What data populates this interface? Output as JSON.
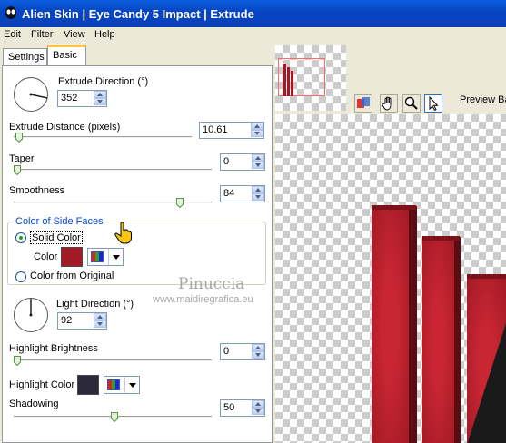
{
  "window": {
    "title": "Alien Skin | Eye Candy 5 Impact | Extrude"
  },
  "menu": [
    "Edit",
    "Filter",
    "View",
    "Help"
  ],
  "tabs": [
    {
      "label": "Settings",
      "active": false
    },
    {
      "label": "Basic",
      "active": true
    }
  ],
  "basic": {
    "extrude_direction": {
      "label": "Extrude Direction (°)",
      "value": "352"
    },
    "extrude_distance": {
      "label": "Extrude Distance (pixels)",
      "value": "10.61",
      "slider_fraction": 0.02
    },
    "taper": {
      "label": "Taper",
      "value": "0",
      "slider_fraction": 0.0
    },
    "smoothness": {
      "label": "Smoothness",
      "value": "84",
      "slider_fraction": 0.84
    },
    "side_faces": {
      "group_label": "Color of Side Faces",
      "solid_color_label": "Solid Color",
      "color_label": "Color",
      "color_value": "#a11a25",
      "from_original_label": "Color from Original",
      "selected": "solid"
    },
    "light_direction": {
      "label": "Light Direction (°)",
      "value": "92"
    },
    "highlight_brightness": {
      "label": "Highlight Brightness",
      "value": "0",
      "slider_fraction": 0.0
    },
    "highlight_color": {
      "label": "Highlight Color",
      "color_value": "#2a2a3c"
    },
    "shadowing": {
      "label": "Shadowing",
      "value": "50",
      "slider_fraction": 0.5
    }
  },
  "preview": {
    "toolbar_label": "Preview Ba",
    "tools": [
      "preview-toggle-icon",
      "hand-icon",
      "zoom-icon",
      "pointer-icon"
    ]
  },
  "watermark": {
    "name": "Pinuccia",
    "url": "www.maidiregrafica.eu"
  },
  "colors": {
    "accent_red": "#a11a25",
    "title_blue": "#0846c4"
  }
}
